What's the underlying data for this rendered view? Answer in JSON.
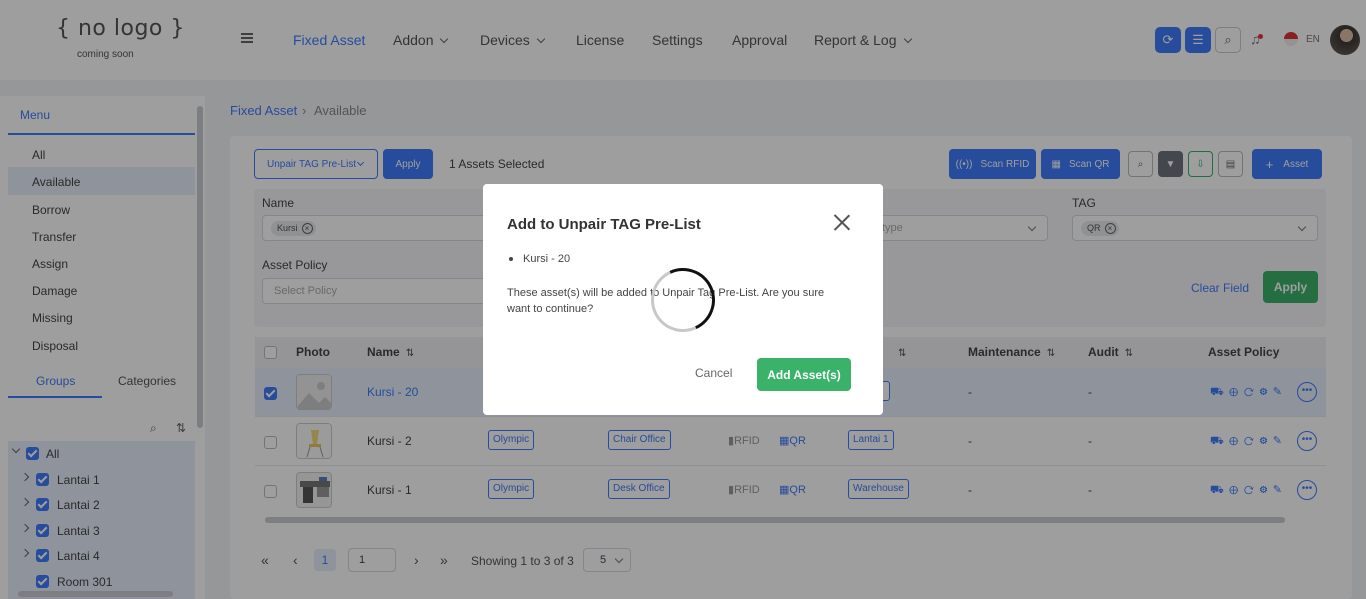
{
  "header": {
    "logo_main": "{ no logo }",
    "logo_sub": "coming soon",
    "nav": [
      {
        "label": "Fixed Asset",
        "active": true
      },
      {
        "label": "Addon"
      },
      {
        "label": "Devices"
      },
      {
        "label": "License"
      },
      {
        "label": "Settings"
      },
      {
        "label": "Approval"
      },
      {
        "label": "Report & Log"
      }
    ],
    "lang": "EN"
  },
  "sidebar": {
    "menu_title": "Menu",
    "items": [
      "All",
      "Available",
      "Borrow",
      "Transfer",
      "Assign",
      "Damage",
      "Missing",
      "Disposal"
    ],
    "tabs": [
      "Groups",
      "Categories"
    ],
    "tree": [
      "All",
      "Lantai 1",
      "Lantai 2",
      "Lantai 3",
      "Lantai 4",
      "Room 301"
    ]
  },
  "breadcrumb": {
    "root": "Fixed Asset",
    "current": "Available"
  },
  "toolbar": {
    "action_select": "Unpair TAG Pre-List",
    "apply": "Apply",
    "selected_count": "1 Assets Selected",
    "scan_rfid": "Scan RFID",
    "scan_qr": "Scan QR",
    "add_asset": "Asset"
  },
  "filters": {
    "name_label": "Name",
    "name_chip": "Kursi",
    "type_placeholder": "type",
    "tag_label": "TAG",
    "tag_chip": "QR",
    "policy_label": "Asset Policy",
    "policy_placeholder": "Select Policy",
    "clear": "Clear Field",
    "apply": "Apply"
  },
  "table": {
    "headers": [
      "Photo",
      "Name",
      "Maintenance",
      "Audit",
      "Asset Policy"
    ],
    "rows": [
      {
        "name": "Kursi - 20",
        "brand": "",
        "category": "",
        "rfid": "",
        "qr": "",
        "location": "",
        "maintenance": "-",
        "audit": "-"
      },
      {
        "name": "Kursi - 2",
        "brand": "Olympic",
        "category": "Chair Office",
        "rfid": "RFID",
        "qr": "QR",
        "location": "Lantai 1",
        "maintenance": "-",
        "audit": "-"
      },
      {
        "name": "Kursi - 1",
        "brand": "Olympic",
        "category": "Desk Office",
        "rfid": "RFID",
        "qr": "QR",
        "location": "Warehouse",
        "maintenance": "-",
        "audit": "-"
      }
    ]
  },
  "pager": {
    "page": "1",
    "goto": "1",
    "showing": "Showing 1 to 3 of 3",
    "size": "5"
  },
  "modal": {
    "title": "Add to Unpair TAG Pre-List",
    "item": "Kursi - 20",
    "message": "These asset(s) will be added to Unpair Tag Pre-List. Are you sure want to continue?",
    "cancel": "Cancel",
    "confirm": "Add Asset(s)"
  },
  "colors": {
    "accent": "#3e7bfa",
    "success": "#3ab26a"
  }
}
